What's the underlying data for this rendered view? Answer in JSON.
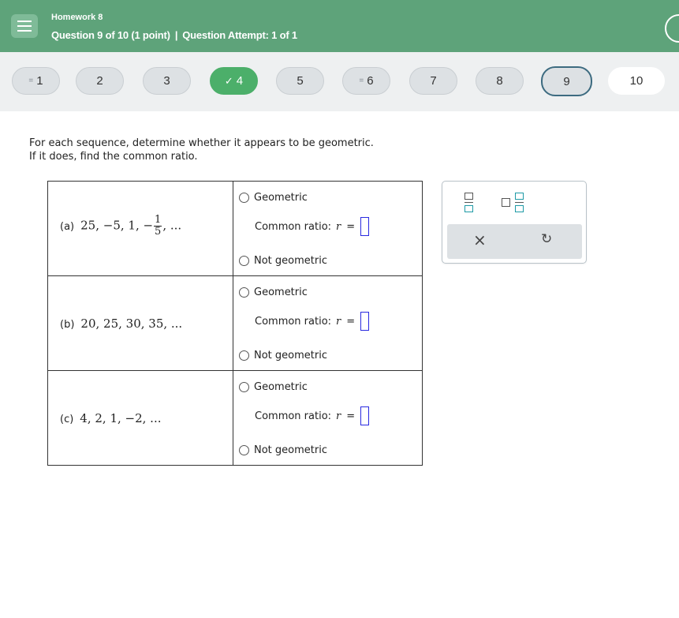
{
  "header": {
    "homework_title": "Homework 8",
    "question_info": "Question 9 of 10 (1 point)",
    "separator": "|",
    "attempt_info": "Question Attempt: 1 of 1"
  },
  "nav": {
    "questions": [
      {
        "label": "1",
        "marker": "=",
        "state": "partial"
      },
      {
        "label": "2",
        "marker": "",
        "state": "default"
      },
      {
        "label": "3",
        "marker": "",
        "state": "default"
      },
      {
        "label": "4",
        "marker": "✓",
        "state": "done"
      },
      {
        "label": "5",
        "marker": "",
        "state": "default"
      },
      {
        "label": "6",
        "marker": "=",
        "state": "partial"
      },
      {
        "label": "7",
        "marker": "",
        "state": "default"
      },
      {
        "label": "8",
        "marker": "",
        "state": "default"
      },
      {
        "label": "9",
        "marker": "",
        "state": "current"
      },
      {
        "label": "10",
        "marker": "",
        "state": "plain"
      }
    ]
  },
  "instructions": {
    "line1": "For each sequence, determine whether it appears to be geometric.",
    "line2": "If it does, find the common ratio."
  },
  "problems": [
    {
      "label": "(a)",
      "sequence_lead": "25, −5, 1, −",
      "fraction_num": "1",
      "fraction_den": "5",
      "sequence_tail": ", ...",
      "option_geometric": "Geometric",
      "ratio_label": "Common ratio:",
      "ratio_var": "r",
      "ratio_eq": "=",
      "option_not": "Not geometric"
    },
    {
      "label": "(b)",
      "sequence_lead": "20, 25, 30, 35, ...",
      "option_geometric": "Geometric",
      "ratio_label": "Common ratio:",
      "ratio_var": "r",
      "ratio_eq": "=",
      "option_not": "Not geometric"
    },
    {
      "label": "(c)",
      "sequence_lead": "4, 2, 1, −2, ...",
      "option_geometric": "Geometric",
      "ratio_label": "Common ratio:",
      "ratio_var": "r",
      "ratio_eq": "=",
      "option_not": "Not geometric"
    }
  ],
  "palette": {
    "clear_symbol": "×",
    "undo_symbol": "↻"
  },
  "colors": {
    "header_bg": "#5ea37a",
    "done_badge": "#4caf6a",
    "current_border": "#3d6b80",
    "answer_box_border": "#2a2ae0",
    "palette_accent": "#1e9aa6"
  }
}
